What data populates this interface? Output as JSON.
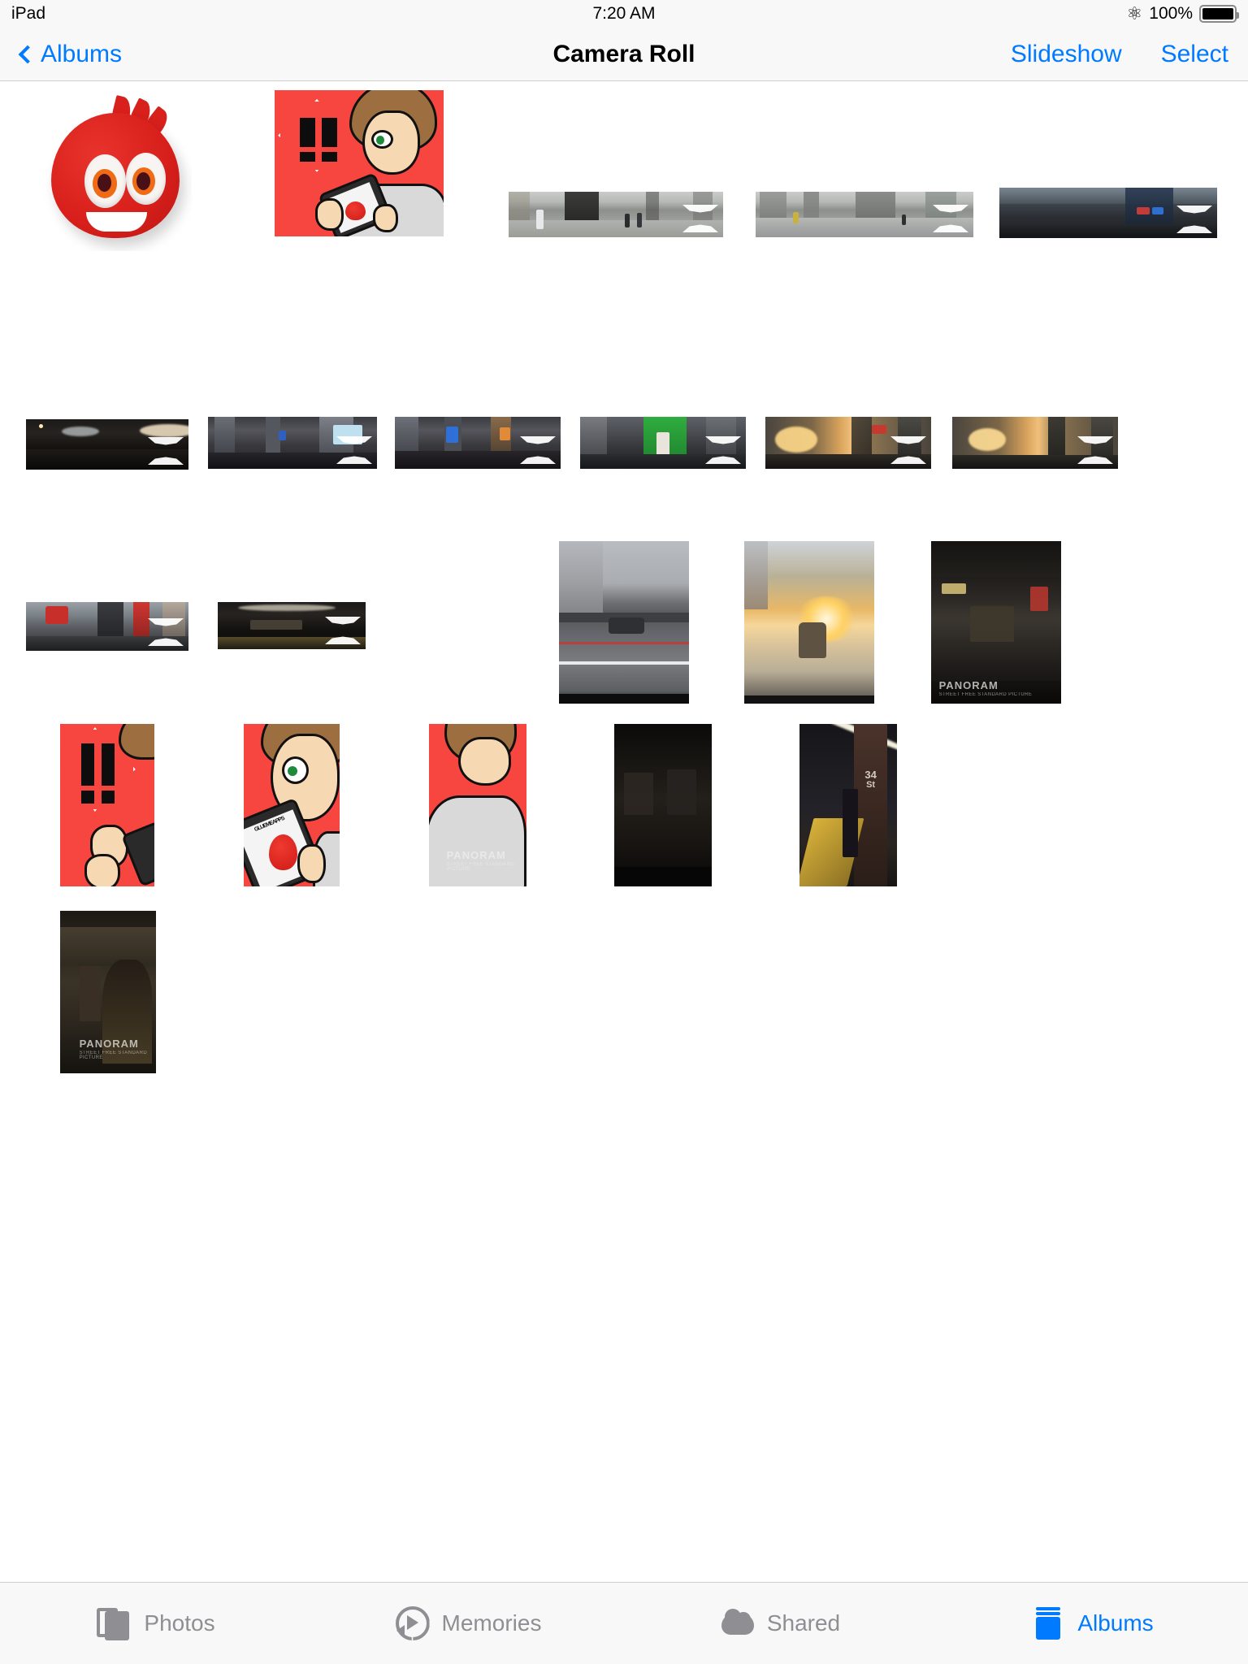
{
  "status_bar": {
    "device": "iPad",
    "time": "7:20 AM",
    "bluetooth_icon": "bluetooth-icon",
    "battery_percent": "100%",
    "battery_level": 100
  },
  "nav_bar": {
    "back_label": "Albums",
    "back_icon": "chevron-left-icon",
    "title": "Camera Roll",
    "slideshow_label": "Slideshow",
    "select_label": "Select"
  },
  "grid": {
    "columns": 5,
    "rows": [
      {
        "row_index": 0,
        "items": [
          {
            "col": 0,
            "name": "photo-mascot-logo",
            "kind": "logo-mascot",
            "badge": "none",
            "orientation": "square",
            "caption": "Red blob mascot logo"
          },
          {
            "col": 1,
            "name": "photo-cartoon-full",
            "kind": "cartoon",
            "badge": "none",
            "orientation": "portrait",
            "caption": "Cartoon boy with phone on red background"
          },
          {
            "col": 2,
            "name": "photo-panorama-plaza",
            "kind": "panorama-day",
            "badge": "panorama-badge-icon",
            "orientation": "panorama",
            "caption": "Daytime city plaza panorama"
          },
          {
            "col": 3,
            "name": "photo-panorama-street",
            "kind": "panorama-day",
            "badge": "panorama-badge-icon",
            "orientation": "panorama",
            "caption": "Daytime street intersection panorama"
          },
          {
            "col": 4,
            "name": "photo-panorama-station",
            "kind": "panorama-station",
            "badge": "panorama-badge-icon",
            "orientation": "panorama",
            "caption": "Station concourse panorama"
          }
        ]
      },
      {
        "row_index": 1,
        "items": [
          {
            "col": 0,
            "name": "photo-panorama-terminal",
            "kind": "panorama-dark",
            "badge": "panorama-badge-icon",
            "orientation": "panorama",
            "caption": "Dark terminal interior panorama"
          },
          {
            "col": 1,
            "name": "photo-panorama-nightcity-1",
            "kind": "panorama-night",
            "badge": "panorama-badge-icon",
            "orientation": "panorama",
            "caption": "Night city street panorama"
          },
          {
            "col": 2,
            "name": "photo-panorama-nightcity-2",
            "kind": "panorama-night",
            "badge": "panorama-badge-icon",
            "orientation": "panorama",
            "caption": "Night crosswalk panorama"
          },
          {
            "col": 3,
            "name": "photo-panorama-greenstore",
            "kind": "panorama-green",
            "badge": "panorama-badge-icon",
            "orientation": "panorama",
            "caption": "Green storefront street panorama"
          },
          {
            "col": 4,
            "name": "photo-panorama-sunset",
            "kind": "panorama-sunset",
            "badge": "panorama-badge-icon",
            "orientation": "panorama",
            "caption": "Sunset street panorama"
          }
        ]
      },
      {
        "row_index": 2,
        "items": [
          {
            "col": 0,
            "name": "photo-panorama-redsign",
            "kind": "panorama-redsign",
            "badge": "panorama-badge-icon",
            "orientation": "panorama",
            "caption": "Street with red signage panorama"
          },
          {
            "col": 1,
            "name": "photo-panorama-subwaytrain",
            "kind": "panorama-dark",
            "badge": "panorama-badge-icon",
            "orientation": "panorama",
            "caption": "Dark subway platform panorama"
          },
          {
            "col": 2,
            "name": "photo-street-building",
            "kind": "vertical-building",
            "badge": "none",
            "orientation": "portrait",
            "caption": "Street and building vertical photo"
          },
          {
            "col": 3,
            "name": "photo-street-sunflare",
            "kind": "vertical-sun",
            "badge": "none",
            "orientation": "portrait",
            "caption": "Sun flare down the avenue"
          },
          {
            "col": 4,
            "name": "photo-storefront-night",
            "kind": "vertical-storefront",
            "badge": "none",
            "orientation": "portrait",
            "watermark": {
              "main": "PANORAM",
              "sub": "STREET FREE STANDARD PICTURE"
            },
            "caption": "Night storefront with watermark"
          }
        ]
      },
      {
        "row_index": 3,
        "items": [
          {
            "col": 0,
            "name": "photo-cartoon-crop-bang",
            "kind": "cartoon-crop-bang",
            "badge": "none",
            "orientation": "portrait",
            "caption": "Cartoon crop with exclamation burst"
          },
          {
            "col": 1,
            "name": "photo-cartoon-crop-face",
            "kind": "cartoon-crop-face",
            "badge": "none",
            "orientation": "portrait",
            "caption": "Cartoon crop of face and phone"
          },
          {
            "col": 2,
            "name": "photo-cartoon-crop-shoulder",
            "kind": "cartoon-crop-shoulder",
            "badge": "none",
            "orientation": "portrait",
            "watermark": {
              "main": "PANORAM",
              "sub": "STREET FREE STANDARD PICTURE"
            },
            "caption": "Cartoon crop of head and shoulder"
          },
          {
            "col": 3,
            "name": "photo-dark-interior",
            "kind": "vertical-black",
            "badge": "none",
            "orientation": "portrait",
            "caption": "Very dark interior photo"
          },
          {
            "col": 4,
            "name": "photo-subway-34st",
            "kind": "vertical-subway",
            "badge": "none",
            "orientation": "portrait",
            "sign": {
              "line1": "34",
              "line2": "St"
            },
            "caption": "Subway platform with 34 St sign"
          }
        ]
      },
      {
        "row_index": 4,
        "items": [
          {
            "col": 0,
            "name": "photo-elevator-person",
            "kind": "vertical-elevator",
            "badge": "none",
            "orientation": "portrait",
            "watermark": {
              "main": "PANORAM",
              "sub": "STREET FREE STANDARD PICTURE"
            },
            "caption": "Person in dim elevator with watermark"
          }
        ]
      }
    ]
  },
  "tab_bar": {
    "tabs": [
      {
        "name": "tab-photos",
        "label": "Photos",
        "icon": "photos-stack-icon",
        "active": false
      },
      {
        "name": "tab-memories",
        "label": "Memories",
        "icon": "memories-replay-icon",
        "active": false
      },
      {
        "name": "tab-shared",
        "label": "Shared",
        "icon": "shared-cloud-icon",
        "active": false
      },
      {
        "name": "tab-albums",
        "label": "Albums",
        "icon": "albums-book-icon",
        "active": true
      }
    ]
  },
  "colors": {
    "tint_blue": "#007aff",
    "inactive_gray": "#8e8e93",
    "chrome_background": "#f8f8f8",
    "separator": "#cfcfcf",
    "page_background": "#ffffff",
    "cartoon_red": "#f7453f"
  }
}
